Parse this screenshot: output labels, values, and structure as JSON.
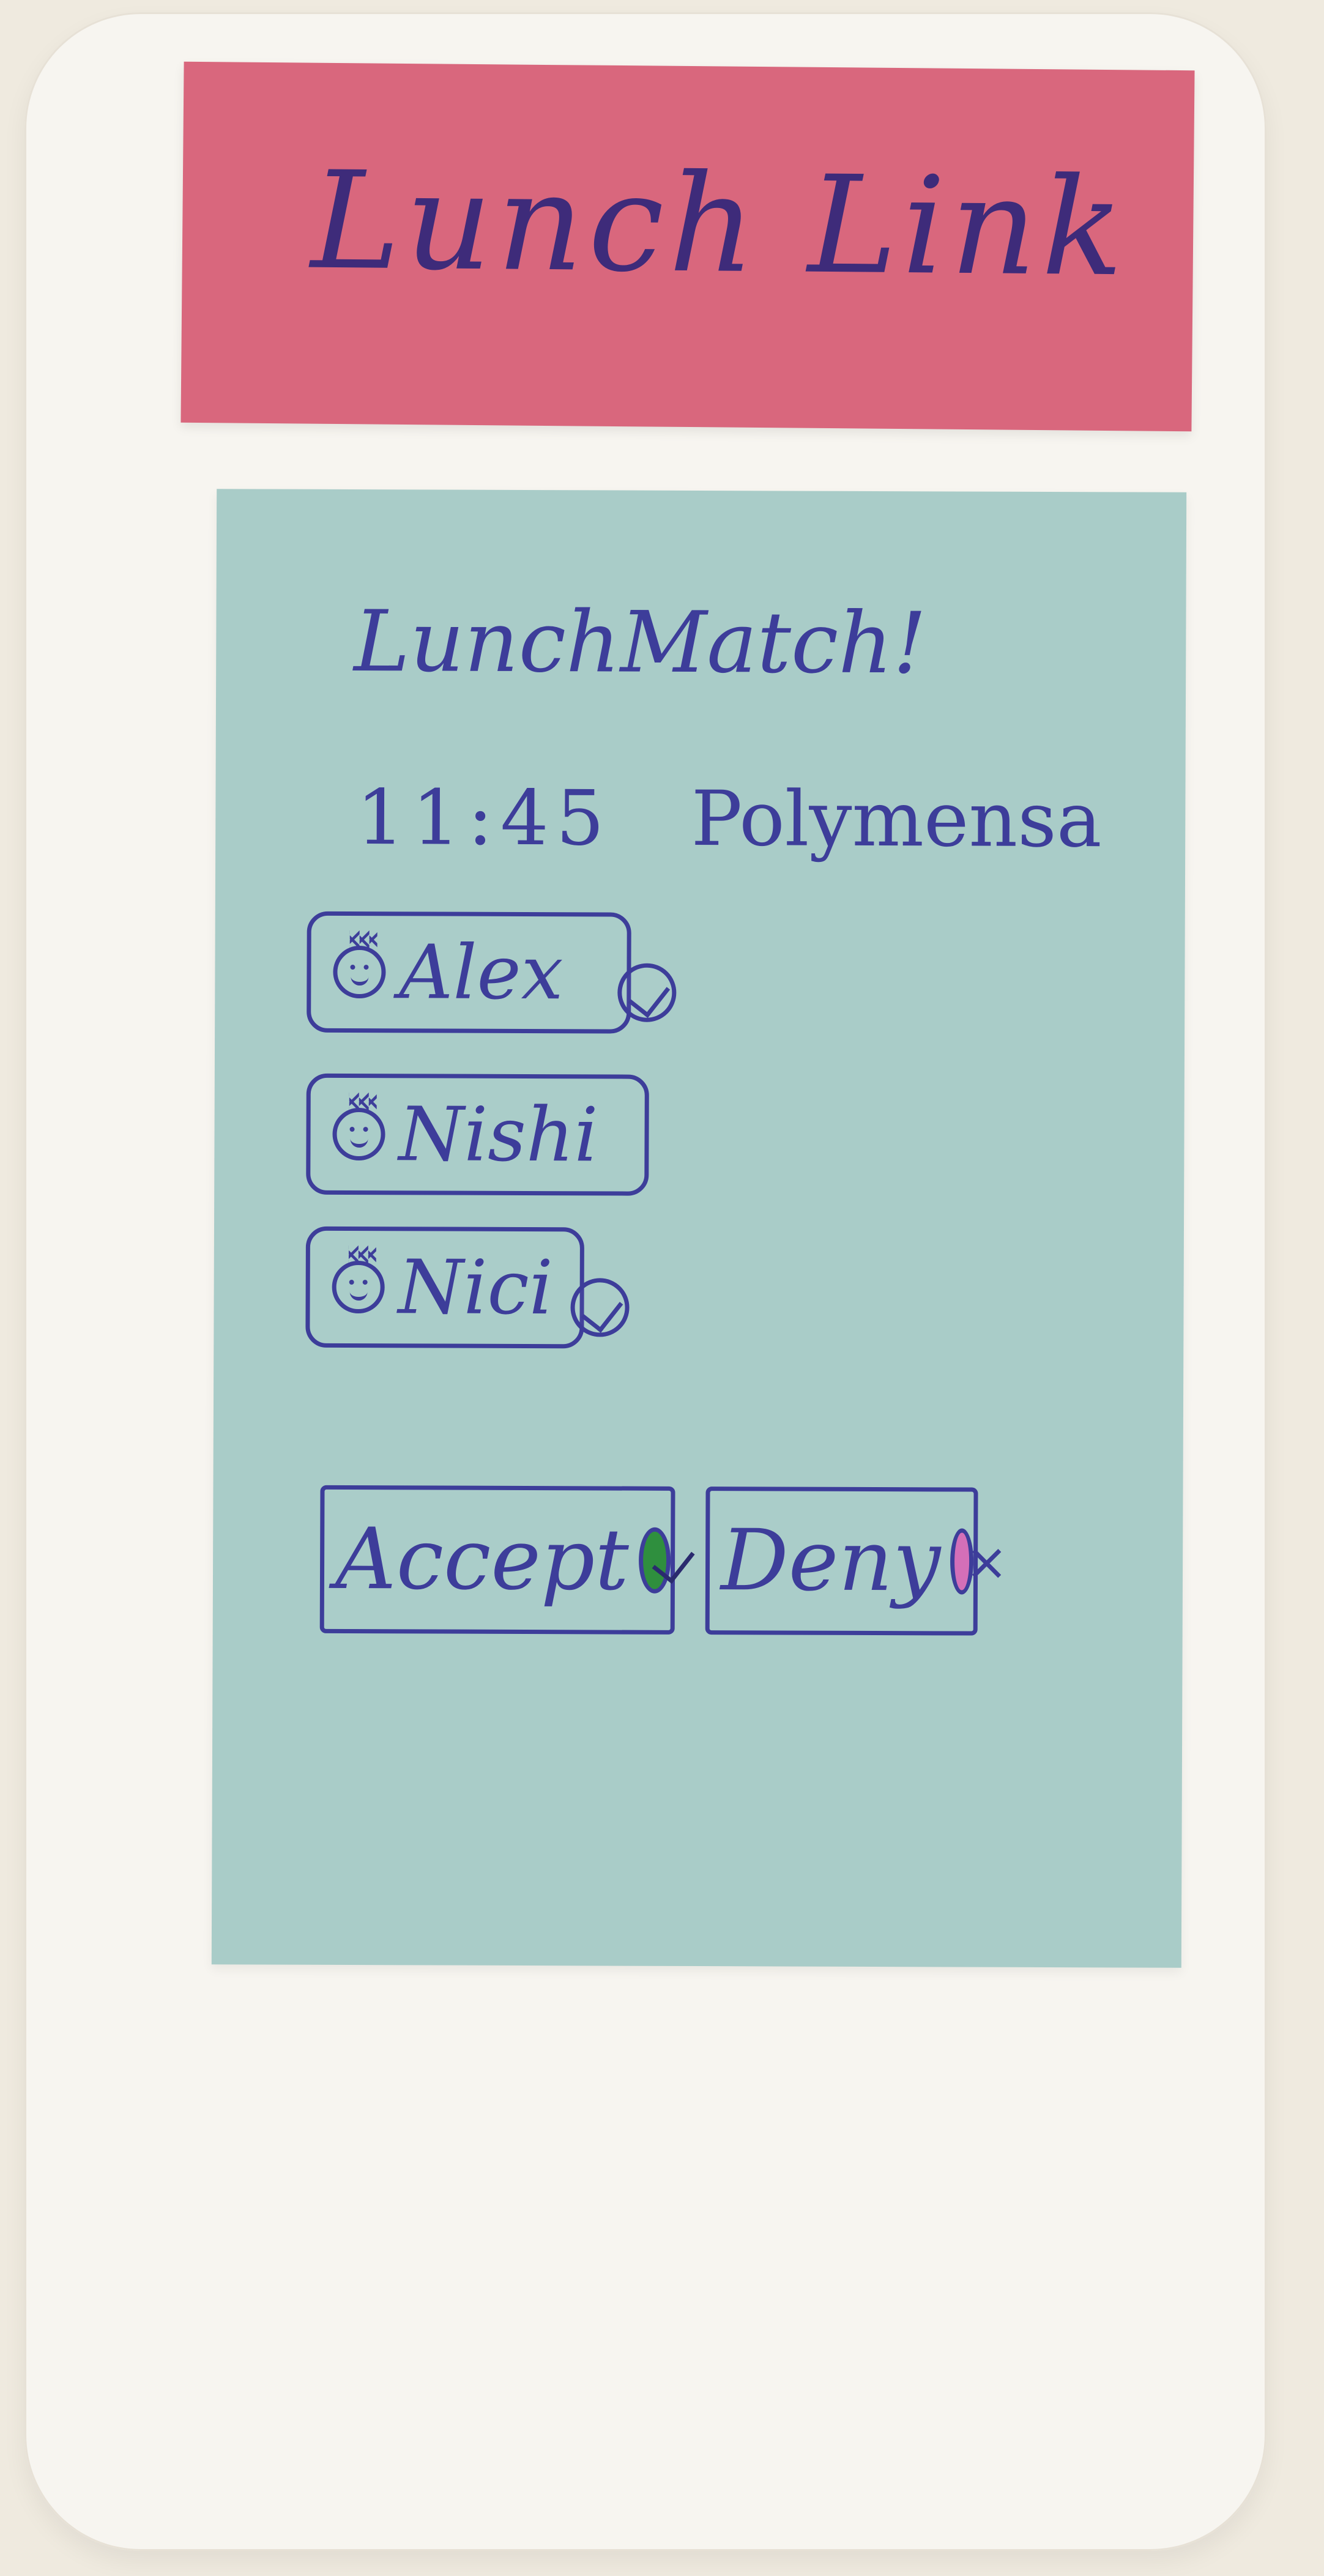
{
  "app": {
    "title": "Lunch Link"
  },
  "match": {
    "headline": "LunchMatch!",
    "time": "11:45",
    "location": "Polymensa"
  },
  "participants": [
    {
      "name": "Alex",
      "status_icon": "check-icon",
      "avatar_icon": "smiley-avatar-icon"
    },
    {
      "name": "Nishi",
      "status_icon": null,
      "avatar_icon": "smiley-avatar-icon"
    },
    {
      "name": "Nici",
      "status_icon": "check-icon",
      "avatar_icon": "smiley-avatar-icon"
    }
  ],
  "actions": {
    "accept": "Accept",
    "deny": "Deny"
  },
  "colors": {
    "header_note": "#d9677d",
    "screen_note": "#a9ccc8",
    "ink": "#3d3d9a",
    "accept_fill": "#2f8f3e",
    "deny_fill": "#d46fb8"
  }
}
